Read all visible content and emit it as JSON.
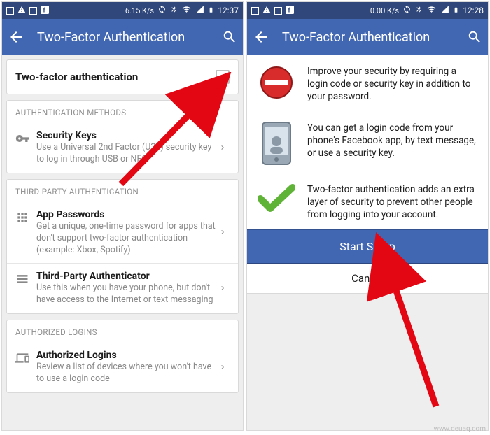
{
  "status": {
    "speed_left": "6.15 K/s",
    "speed_right": "0.00 K/s",
    "time": "12:37",
    "time_right": "12:28"
  },
  "appbar": {
    "title": "Two-Factor Authentication"
  },
  "left": {
    "toggle_label": "Two-factor authentication",
    "section_methods": "AUTHENTICATION METHODS",
    "sk_title": "Security Keys",
    "sk_sub": "Use a Universal 2nd Factor (U2F) security key to log in through USB or NFC",
    "section_tp": "THIRD-PARTY AUTHENTICATION",
    "ap_title": "App Passwords",
    "ap_sub": "Get a unique, one-time password for apps that don't support two-factor authentication (example: Xbox, Spotify)",
    "tpa_title": "Third-Party Authenticator",
    "tpa_sub": "Use this when you have your phone, but don't have access to the Internet or text messaging",
    "section_al": "AUTHORIZED LOGINS",
    "al_title": "Authorized Logins",
    "al_sub": "Review a list of devices where you won't have to use a login code"
  },
  "right": {
    "p1": "Improve your security by requiring a login code or security key in addition to your password.",
    "p2": "You can get a login code from your phone's Facebook app, by text message, or use a security key.",
    "p3": "Two-factor authentication adds an extra layer of security to prevent other people from logging into your account.",
    "start": "Start Setup",
    "cancel": "Cancel"
  },
  "watermark": "www.deuaq.com"
}
